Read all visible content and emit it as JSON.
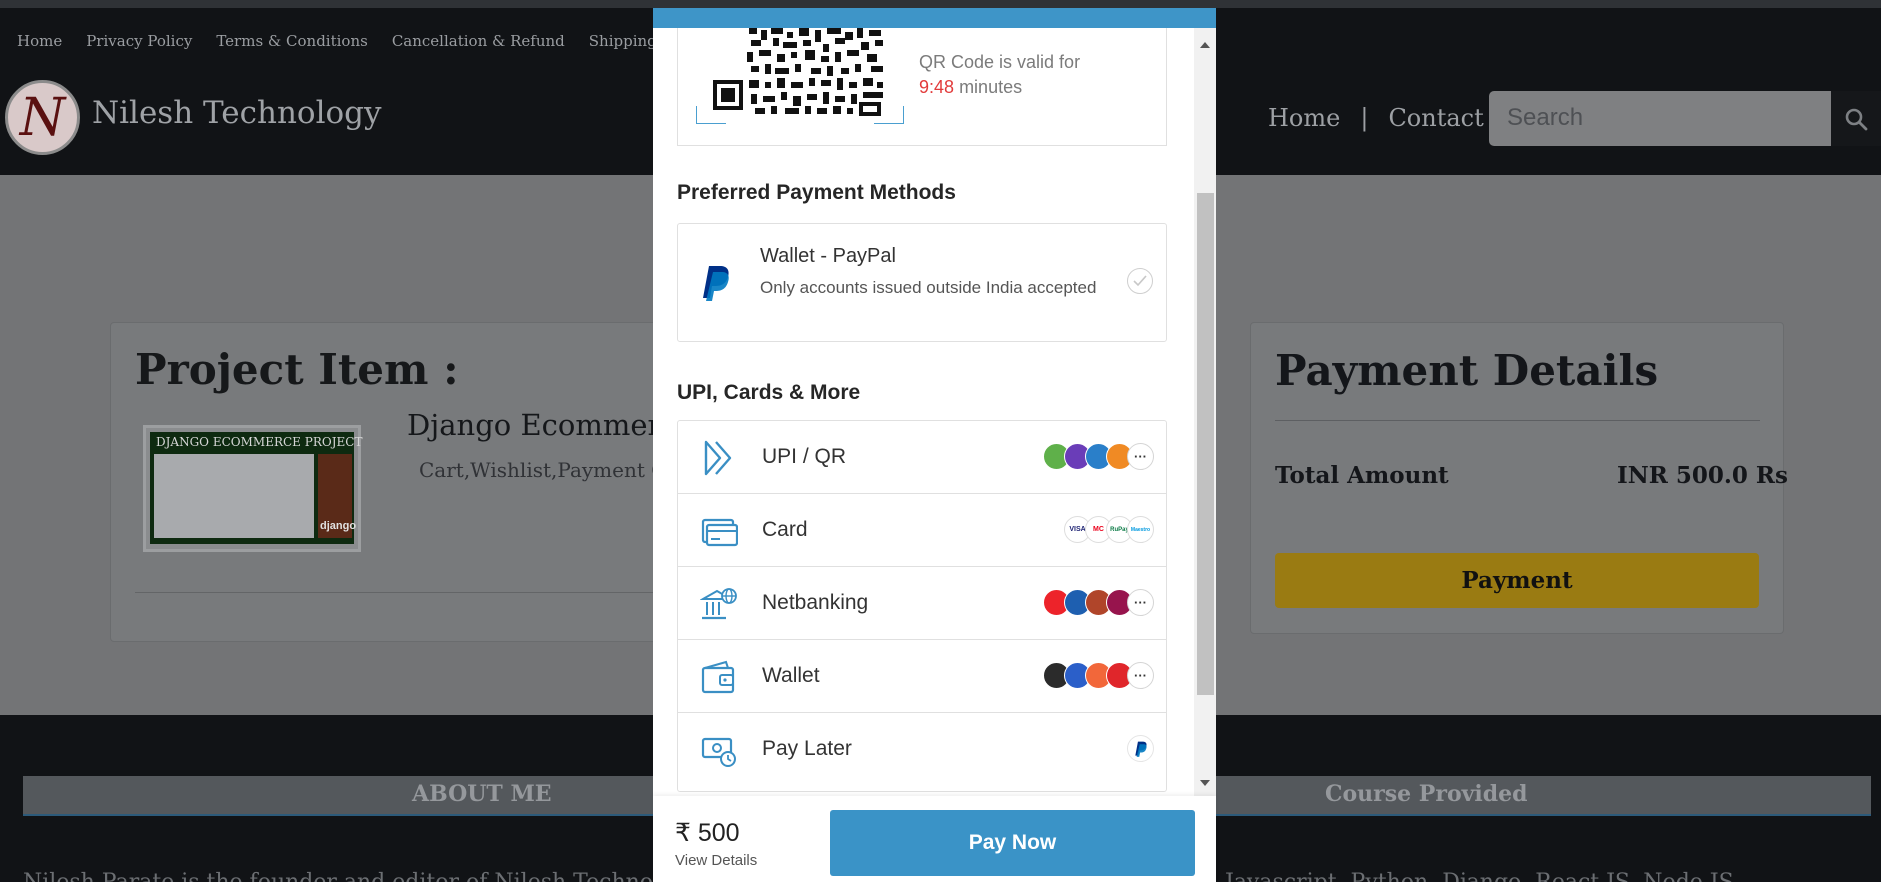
{
  "site": {
    "top_links": [
      "Home",
      "Privacy Policy",
      "Terms & Conditions",
      "Cancellation & Refund",
      "Shipping & De"
    ],
    "brand": "Nilesh Technology",
    "logo_letter": "N",
    "nav": {
      "home": "Home",
      "separator": "|",
      "contact": "Contact"
    },
    "search_placeholder": "Search"
  },
  "project": {
    "heading": "Project Item :",
    "thumb_title": "DJANGO ECOMMERCE PROJECT",
    "thumb_brand": "django",
    "title": "Django Ecommerce",
    "subtitle": "Cart,Wishlist,Payment G"
  },
  "payment_details": {
    "heading": "Payment Details",
    "total_label": "Total Amount",
    "total_value": "INR 500.0 Rs",
    "button": "Payment"
  },
  "footer": {
    "about": "ABOUT ME",
    "course": "Course Provided",
    "left_text": "Nilesh Parate is the founder and editor of Nilesh Technology. He",
    "right_text": "Javascript, Python, Django, React JS, Node JS"
  },
  "modal": {
    "qr_valid_prefix": "QR Code is valid for",
    "qr_time": "9:48",
    "qr_valid_suffix": "minutes",
    "preferred_heading": "Preferred Payment Methods",
    "paypal_name": "Wallet - PayPal",
    "paypal_note": "Only accounts issued outside India accepted",
    "upi_heading": "UPI, Cards & More",
    "methods": [
      {
        "label": "UPI / QR",
        "icon": "upi-icon"
      },
      {
        "label": "Card",
        "icon": "card-icon"
      },
      {
        "label": "Netbanking",
        "icon": "bank-icon"
      },
      {
        "label": "Wallet",
        "icon": "wallet-icon"
      },
      {
        "label": "Pay Later",
        "icon": "paylater-icon"
      }
    ],
    "card_logos": [
      "VISA",
      "MC",
      "RuPay",
      "Maestro"
    ],
    "more_glyph": "···",
    "amount": "₹ 500",
    "view_details": "View Details",
    "pay_now": "Pay Now"
  },
  "colors": {
    "accent": "#3a93c7",
    "timer": "#e23b3b",
    "payment_button": "#f1c40f"
  }
}
